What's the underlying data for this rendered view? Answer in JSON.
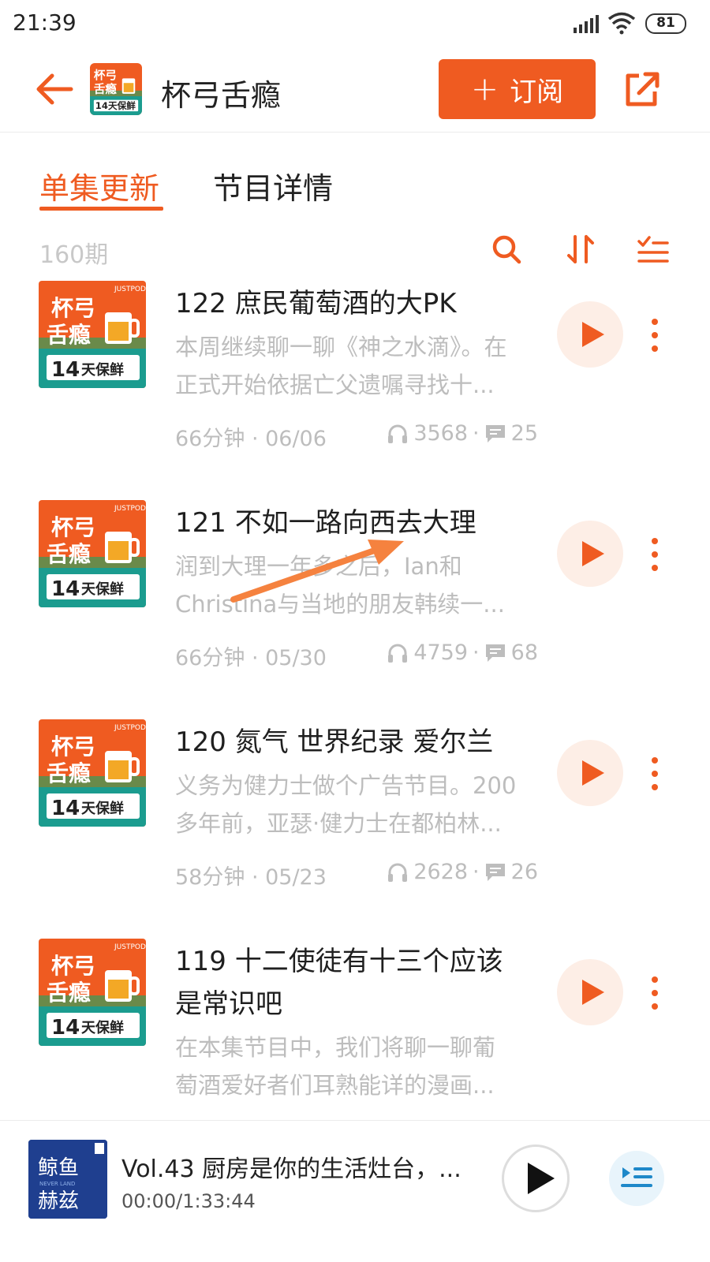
{
  "status_bar": {
    "time": "21:39",
    "battery": "81"
  },
  "header": {
    "title": "杯弓舌瘾",
    "subscribe_label": "订阅"
  },
  "tabs": [
    {
      "label": "单集更新",
      "active": true
    },
    {
      "label": "节目详情",
      "active": false
    }
  ],
  "toolbar": {
    "count": "160期"
  },
  "cover_art": {
    "badge": "JUSTPOD",
    "line1": "杯弓",
    "line2": "舌瘾",
    "days": "14",
    "days_label": "天保鲜"
  },
  "episodes": [
    {
      "title": "122 庶民葡萄酒的大PK",
      "desc_line1": "本周继续聊一聊《神之水滴》。在",
      "desc_line2": "正式开始依据亡父遗嘱寻找十...",
      "duration_date": "66分钟 · 06/06",
      "plays": "3568",
      "comments": "25"
    },
    {
      "title": "121 不如一路向西去大理",
      "desc_line1": "润到大理一年多之后，Ian和",
      "desc_line2": "Christina与当地的朋友韩续一...",
      "duration_date": "66分钟 · 05/30",
      "plays": "4759",
      "comments": "68"
    },
    {
      "title": "120 氮气 世界纪录 爱尔兰",
      "desc_line1": "义务为健力士做个广告节目。200",
      "desc_line2": "多年前，亚瑟·健力士在都柏林...",
      "duration_date": "58分钟 · 05/23",
      "plays": "2628",
      "comments": "26"
    },
    {
      "title_line1": "119 十二使徒有十三个应该",
      "title_line2": "是常识吧",
      "desc_line1": "在本集节目中，我们将聊一聊葡",
      "desc_line2": "萄酒爱好者们耳熟能详的漫画..."
    }
  ],
  "player": {
    "title": "Vol.43 厨房是你的生活灶台，...",
    "time": "00:00/1:33:44",
    "cover_text_1": "鲸鱼",
    "cover_text_2": "赫兹",
    "cover_small": "NEVER LAND"
  },
  "colors": {
    "accent": "#ef5b21",
    "muted": "#bdbdbd",
    "play_bg": "#fdeee6"
  }
}
